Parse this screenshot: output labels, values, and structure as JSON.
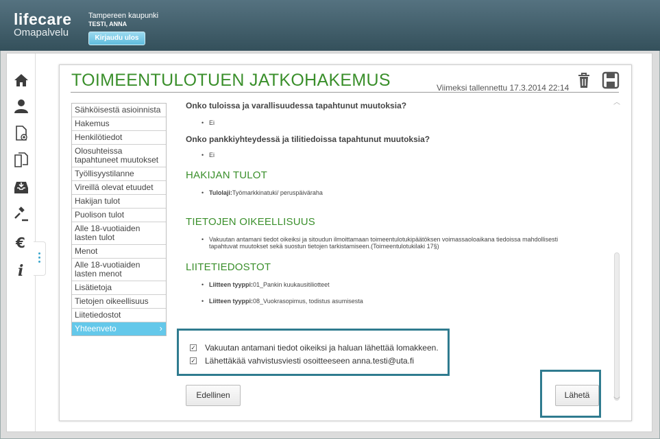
{
  "header": {
    "brand": "lifecare",
    "brand_sub": "Omapalvelu",
    "organization": "Tampereen kaupunki",
    "user_name": "TESTI, ANNA",
    "logout_label": "Kirjaudu ulos"
  },
  "nav_icons": [
    "home-icon",
    "user-icon",
    "new-document-icon",
    "documents-icon",
    "inbox-icon",
    "gavel-icon",
    "euro-icon",
    "info-icon"
  ],
  "form": {
    "title": "TOIMEENTULOTUEN JATKOHAKEMUS",
    "saved": "Viimeksi tallennettu 17.3.2014 22:14"
  },
  "sections": [
    "Sähköisestä asioinnista",
    "Hakemus",
    "Henkilötiedot",
    "Olosuhteissa tapahtuneet muutokset",
    "Työllisyystilanne",
    "Vireillä olevat etuudet",
    "Hakijan tulot",
    "Puolison tulot",
    "Alle 18-vuotiaiden lasten tulot",
    "Menot",
    "Alle 18-vuotiaiden lasten menot",
    "Lisätietoja",
    "Tietojen oikeellisuus",
    "Liitetiedostot",
    "Yhteenveto"
  ],
  "summary": {
    "q1": "Onko tuloissa ja varallisuudessa tapahtunut muutoksia?",
    "a1": "Ei",
    "q2": "Onko pankkiyhteydessä ja  tilitiedoissa tapahtunut muutoksia?",
    "a2": "Ei",
    "h_income": "HAKIJAN TULOT",
    "income_label": "Tulolaji:",
    "income_value": "Työmarkkinatuki/ peruspäiväraha",
    "h_accuracy": "TIETOJEN OIKEELLISUUS",
    "accuracy_text_1": "Vakuutan antamani tiedot oikeiksi ja sitoudun ilmoittamaan toimeentulotukipäätöksen voimassaoloaikana tiedoissa mahdollisesti",
    "accuracy_text_2": "tapahtuvat muutokset sekä suostun tietojen tarkistamiseen.(Toimeentulotukilaki 17§)",
    "h_attachments": "LIITETIEDOSTOT",
    "att_label": "Liitteen tyyppi:",
    "att1": "01_Pankin kuukausitiliotteet",
    "att2": "08_Vuokrasopimus, todistus asumisesta"
  },
  "confirm": {
    "check1": "Vakuutan antamani tiedot oikeiksi ja haluan lähettää lomakkeen.",
    "check2": "Lähettäkää vahvistusviesti osoitteeseen anna.testi@uta.fi",
    "check1_checked": true,
    "check2_checked": true
  },
  "buttons": {
    "previous": "Edellinen",
    "send": "Lähetä"
  }
}
